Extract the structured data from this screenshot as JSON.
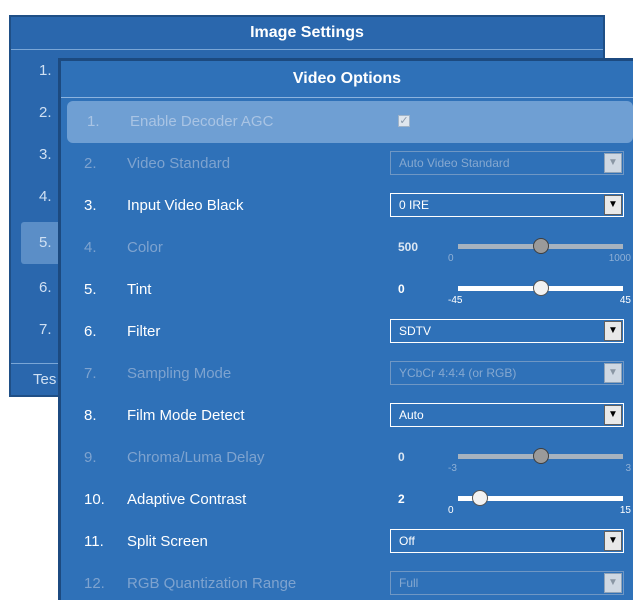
{
  "back_window": {
    "title": "Image Settings",
    "rows": [
      "1.",
      "2.",
      "3.",
      "4.",
      "5.",
      "6.",
      "7."
    ],
    "bottom_text": "Tes"
  },
  "front_window": {
    "title": "Video Options",
    "items": [
      {
        "num": "1.",
        "label": "Enable Decoder AGC",
        "control": "checkbox",
        "checked": true
      },
      {
        "num": "2.",
        "label": "Video Standard",
        "control": "dropdown",
        "value": "Auto Video Standard"
      },
      {
        "num": "3.",
        "label": "Input Video Black",
        "control": "dropdown",
        "value": "0 IRE"
      },
      {
        "num": "4.",
        "label": "Color",
        "control": "slider",
        "value": "500",
        "min": "0",
        "max": "1000"
      },
      {
        "num": "5.",
        "label": "Tint",
        "control": "slider",
        "value": "0",
        "min": "-45",
        "max": "45"
      },
      {
        "num": "6.",
        "label": "Filter",
        "control": "dropdown",
        "value": "SDTV"
      },
      {
        "num": "7.",
        "label": "Sampling Mode",
        "control": "dropdown",
        "value": "YCbCr 4:4:4 (or RGB)"
      },
      {
        "num": "8.",
        "label": "Film Mode Detect",
        "control": "dropdown",
        "value": "Auto"
      },
      {
        "num": "9.",
        "label": "Chroma/Luma Delay",
        "control": "slider",
        "value": "0",
        "min": "-3",
        "max": "3"
      },
      {
        "num": "10.",
        "label": "Adaptive Contrast",
        "control": "slider",
        "value": "2",
        "min": "0",
        "max": "15"
      },
      {
        "num": "11.",
        "label": "Split Screen",
        "control": "dropdown",
        "value": "Off"
      },
      {
        "num": "12.",
        "label": "RGB Quantization Range",
        "control": "dropdown",
        "value": "Full"
      }
    ]
  },
  "icons": {
    "checkmark": "check-icon",
    "dropdown_arrow": "chevron-down-icon"
  },
  "colors": {
    "window_bg": "#2f71b8",
    "selected_row": "#6f9fd3",
    "disabled_text": "#7ea3cf"
  }
}
